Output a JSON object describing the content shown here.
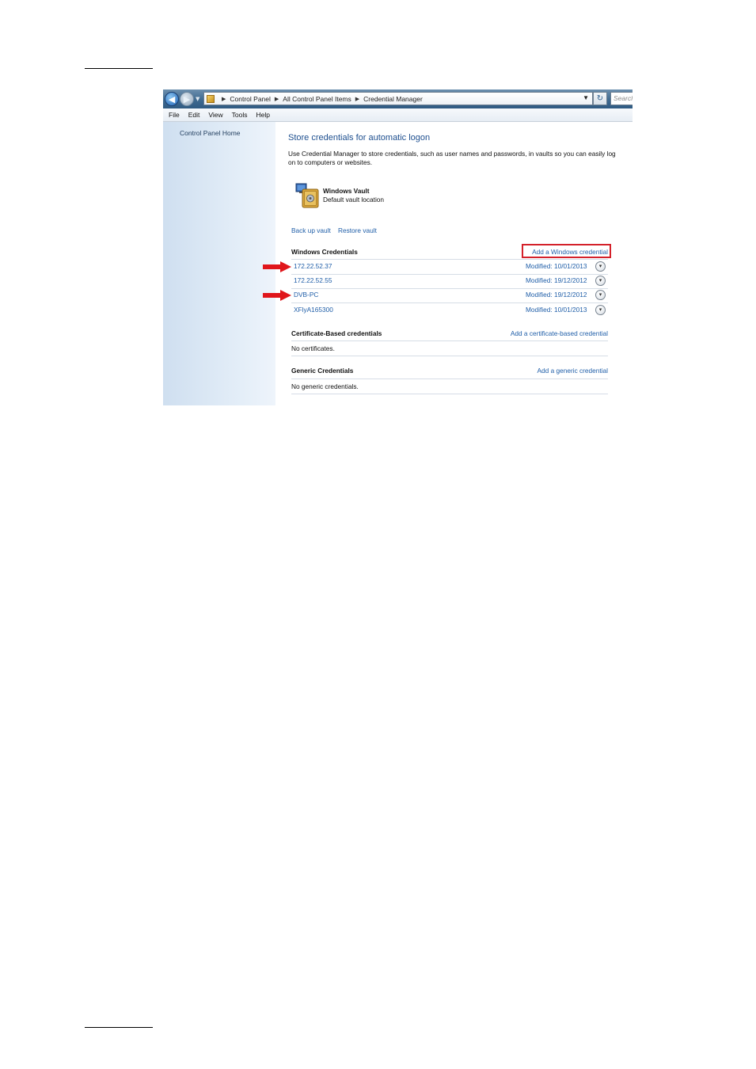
{
  "window": {
    "breadcrumb": [
      "Control Panel",
      "All Control Panel Items",
      "Credential Manager"
    ],
    "search_placeholder": "Search"
  },
  "menu": [
    "File",
    "Edit",
    "View",
    "Tools",
    "Help"
  ],
  "left_pane": {
    "home_link": "Control Panel Home"
  },
  "main": {
    "title": "Store credentials for automatic logon",
    "description": "Use Credential Manager to store credentials, such as user names and passwords, in vaults so you can easily log on to computers or websites.",
    "vault": {
      "name": "Windows Vault",
      "location": "Default vault location"
    },
    "backup_link": "Back up vault",
    "restore_link": "Restore vault",
    "windows_credentials": {
      "title": "Windows Credentials",
      "add_link": "Add a Windows credential",
      "items": [
        {
          "name": "172.22.52.37",
          "modified": "Modified:  10/01/2013",
          "arrow": true
        },
        {
          "name": "172.22.52.55",
          "modified": "Modified:  19/12/2012",
          "arrow": false
        },
        {
          "name": "DVB-PC",
          "modified": "Modified:  19/12/2012",
          "arrow": true
        },
        {
          "name": "XFlyA165300",
          "modified": "Modified:  10/01/2013",
          "arrow": false
        }
      ]
    },
    "certificate_credentials": {
      "title": "Certificate-Based credentials",
      "add_link": "Add a certificate-based credential",
      "empty_text": "No certificates."
    },
    "generic_credentials": {
      "title": "Generic Credentials",
      "add_link": "Add a generic credential",
      "empty_text": "No generic credentials."
    }
  },
  "colors": {
    "link": "#1f5ea8",
    "title": "#1e4f8f",
    "highlight": "#d4212a",
    "arrow": "#e0161b"
  }
}
